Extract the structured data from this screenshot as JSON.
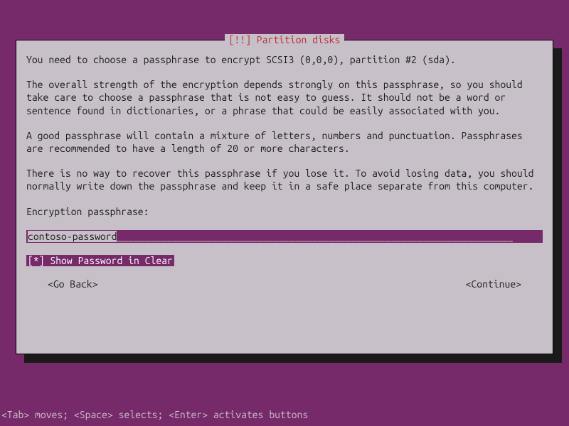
{
  "dialog": {
    "title": "[!!] Partition disks",
    "paragraphs": {
      "p1": "You need to choose a passphrase to encrypt SCSI3 (0,0,0), partition #2 (sda).",
      "p2": "The overall strength of the encryption depends strongly on this passphrase, so you should take care to choose a passphrase that is not easy to guess. It should not be a word or sentence found in dictionaries, or a phrase that could be easily associated with you.",
      "p3": "A good passphrase will contain a mixture of letters, numbers and punctuation. Passphrases are recommended to have a length of 20 or more characters.",
      "p4": "There is no way to recover this passphrase if you lose it. To avoid losing data, you should normally write down the passphrase and keep it in a safe place separate from this computer."
    },
    "input_label": "Encryption passphrase:",
    "input_value": "contoso-password",
    "checkbox": {
      "marker": "[*]",
      "label": " Show Password in Clear"
    },
    "buttons": {
      "back": "<Go Back>",
      "continue": "<Continue>"
    }
  },
  "help_bar": "<Tab> moves; <Space> selects; <Enter> activates buttons"
}
